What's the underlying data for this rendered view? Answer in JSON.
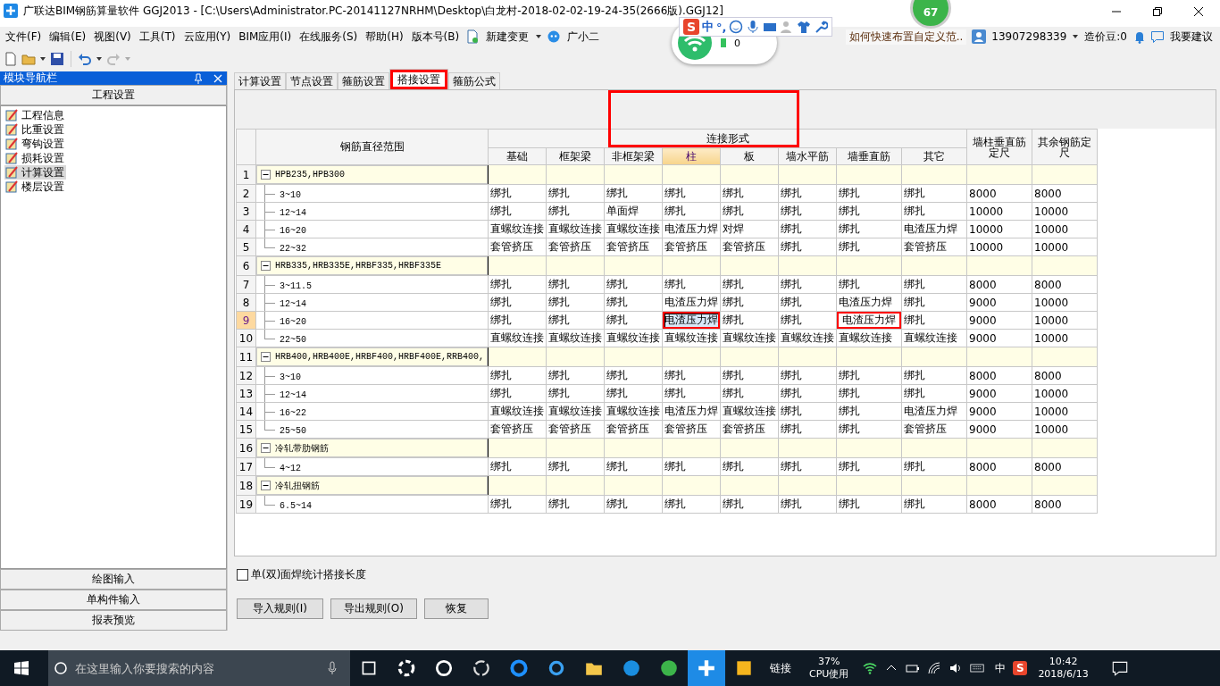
{
  "window": {
    "title": "广联达BIM钢筋算量软件 GGJ2013 - [C:\\Users\\Administrator.PC-20141127NRHM\\Desktop\\白龙村-2018-02-02-19-24-35(2666版).GGJ12]"
  },
  "menu": [
    "文件(F)",
    "编辑(E)",
    "视图(V)",
    "工具(T)",
    "云应用(Y)",
    "BIM应用(I)",
    "在线服务(S)",
    "帮助(H)",
    "版本号(B)"
  ],
  "menu_extra": [
    {
      "kind": "dropdown",
      "label": "新建变更"
    },
    {
      "kind": "assistant",
      "label": "广小二"
    }
  ],
  "notice": "如何快速布置自定义范..",
  "account": {
    "phone": "13907298339",
    "beans": "造价豆:0",
    "feedback": "我要建议"
  },
  "ime": {
    "logo": "S",
    "mode": "中",
    "punct": "°,"
  },
  "status_widget": {
    "count": "0"
  },
  "badge": "67",
  "nav": {
    "title": "模块导航栏",
    "section": "工程设置",
    "items": [
      {
        "label": "工程信息",
        "selected": false
      },
      {
        "label": "比重设置",
        "selected": false
      },
      {
        "label": "弯钩设置",
        "selected": false
      },
      {
        "label": "损耗设置",
        "selected": false
      },
      {
        "label": "计算设置",
        "selected": true
      },
      {
        "label": "楼层设置",
        "selected": false
      }
    ],
    "footer": [
      "绘图输入",
      "单构件输入",
      "报表预览"
    ]
  },
  "tabs": [
    {
      "label": "计算设置",
      "selected": false,
      "marked": false
    },
    {
      "label": "节点设置",
      "selected": false,
      "marked": false
    },
    {
      "label": "箍筋设置",
      "selected": false,
      "marked": false
    },
    {
      "label": "搭接设置",
      "selected": true,
      "marked": true
    },
    {
      "label": "箍筋公式",
      "selected": false,
      "marked": false
    }
  ],
  "table": {
    "range_header": "钢筋直径范围",
    "group_header": "连接形式",
    "group_header_marked": true,
    "columns": [
      {
        "label": "基础",
        "selected": false
      },
      {
        "label": "框架梁",
        "selected": false
      },
      {
        "label": "非框架梁",
        "selected": false
      },
      {
        "label": "柱",
        "selected": true
      },
      {
        "label": "板",
        "selected": false
      },
      {
        "label": "墙水平筋",
        "selected": false
      },
      {
        "label": "墙垂直筋",
        "selected": false
      },
      {
        "label": "其它",
        "selected": false
      }
    ],
    "length_columns": [
      "墙柱垂直筋定尺",
      "其余钢筋定尺"
    ],
    "groups": [
      {
        "number": "1",
        "label": "HPB235,HPB300",
        "expanded": true,
        "rows": [
          {
            "number": "2",
            "range": "3~10",
            "selected": false,
            "cells": [
              "绑扎",
              "绑扎",
              "绑扎",
              "绑扎",
              "绑扎",
              "绑扎",
              "绑扎",
              "绑扎",
              "8000",
              "8000"
            ]
          },
          {
            "number": "3",
            "range": "12~14",
            "selected": false,
            "cells": [
              "绑扎",
              "绑扎",
              "单面焊",
              "绑扎",
              "绑扎",
              "绑扎",
              "绑扎",
              "绑扎",
              "10000",
              "10000"
            ]
          },
          {
            "number": "4",
            "range": "16~20",
            "selected": false,
            "cells": [
              "直螺纹连接",
              "直螺纹连接",
              "直螺纹连接",
              "电渣压力焊",
              "对焊",
              "绑扎",
              "绑扎",
              "电渣压力焊",
              "10000",
              "10000"
            ]
          },
          {
            "number": "5",
            "range": "22~32",
            "selected": false,
            "cells": [
              "套管挤压",
              "套管挤压",
              "套管挤压",
              "套管挤压",
              "套管挤压",
              "绑扎",
              "绑扎",
              "套管挤压",
              "10000",
              "10000"
            ]
          }
        ]
      },
      {
        "number": "6",
        "label": "HRB335,HRB335E,HRBF335,HRBF335E",
        "expanded": true,
        "rows": [
          {
            "number": "7",
            "range": "3~11.5",
            "selected": false,
            "cells": [
              "绑扎",
              "绑扎",
              "绑扎",
              "绑扎",
              "绑扎",
              "绑扎",
              "绑扎",
              "绑扎",
              "8000",
              "8000"
            ]
          },
          {
            "number": "8",
            "range": "12~14",
            "selected": false,
            "cells": [
              "绑扎",
              "绑扎",
              "绑扎",
              "电渣压力焊",
              "绑扎",
              "绑扎",
              "电渣压力焊",
              "绑扎",
              "9000",
              "10000"
            ]
          },
          {
            "number": "9",
            "range": "16~20",
            "selected": true,
            "marked": [
              false,
              false,
              false,
              true,
              false,
              false,
              true,
              false,
              false,
              false
            ],
            "cells": [
              "绑扎",
              "绑扎",
              "绑扎",
              "电渣压力焊",
              "绑扎",
              "绑扎",
              "电渣压力焊",
              "绑扎",
              "9000",
              "10000"
            ]
          },
          {
            "number": "10",
            "range": "22~50",
            "selected": false,
            "cells": [
              "直螺纹连接",
              "直螺纹连接",
              "直螺纹连接",
              "直螺纹连接",
              "直螺纹连接",
              "直螺纹连接",
              "直螺纹连接",
              "直螺纹连接",
              "9000",
              "10000"
            ]
          }
        ]
      },
      {
        "number": "11",
        "label": "HRB400,HRB400E,HRBF400,HRBF400E,RRB400,",
        "expanded": true,
        "rows": [
          {
            "number": "12",
            "range": "3~10",
            "selected": false,
            "cells": [
              "绑扎",
              "绑扎",
              "绑扎",
              "绑扎",
              "绑扎",
              "绑扎",
              "绑扎",
              "绑扎",
              "8000",
              "8000"
            ]
          },
          {
            "number": "13",
            "range": "12~14",
            "selected": false,
            "cells": [
              "绑扎",
              "绑扎",
              "绑扎",
              "绑扎",
              "绑扎",
              "绑扎",
              "绑扎",
              "绑扎",
              "9000",
              "10000"
            ]
          },
          {
            "number": "14",
            "range": "16~22",
            "selected": false,
            "cells": [
              "直螺纹连接",
              "直螺纹连接",
              "直螺纹连接",
              "电渣压力焊",
              "直螺纹连接",
              "绑扎",
              "绑扎",
              "电渣压力焊",
              "9000",
              "10000"
            ]
          },
          {
            "number": "15",
            "range": "25~50",
            "selected": false,
            "cells": [
              "套管挤压",
              "套管挤压",
              "套管挤压",
              "套管挤压",
              "套管挤压",
              "绑扎",
              "绑扎",
              "套管挤压",
              "9000",
              "10000"
            ]
          }
        ]
      },
      {
        "number": "16",
        "label": "冷轧带肋钢筋",
        "expanded": true,
        "rows": [
          {
            "number": "17",
            "range": "4~12",
            "selected": false,
            "cells": [
              "绑扎",
              "绑扎",
              "绑扎",
              "绑扎",
              "绑扎",
              "绑扎",
              "绑扎",
              "绑扎",
              "8000",
              "8000"
            ]
          }
        ]
      },
      {
        "number": "18",
        "label": "冷轧扭钢筋",
        "expanded": true,
        "rows": [
          {
            "number": "19",
            "range": "6.5~14",
            "selected": false,
            "cells": [
              "绑扎",
              "绑扎",
              "绑扎",
              "绑扎",
              "绑扎",
              "绑扎",
              "绑扎",
              "绑扎",
              "8000",
              "8000"
            ]
          }
        ]
      }
    ]
  },
  "option": {
    "label": "单(双)面焊统计搭接长度",
    "checked": false
  },
  "buttons": [
    "导入规则(I)",
    "导出规则(O)",
    "恢复"
  ],
  "taskbar": {
    "search_placeholder": "在这里输入你要搜索的内容",
    "link": "链接",
    "cpu_value": "37%",
    "cpu_label": "CPU使用",
    "ime": "中",
    "ime_logo": "S",
    "time": "10:42",
    "date": "2018/6/13"
  }
}
